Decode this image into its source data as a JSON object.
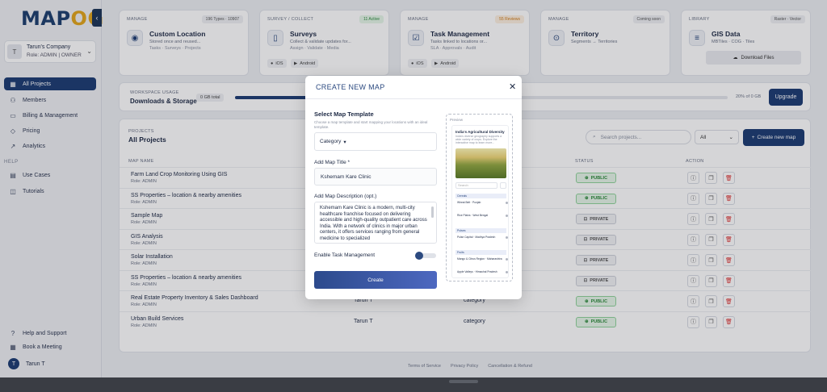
{
  "app": {
    "logo_text": "MAP",
    "logo_accent": "OG",
    "collapse_icon": "chevron-left-icon"
  },
  "company": {
    "avatar": "T",
    "name": "Tarun's Company",
    "role": "Role: ADMIN | OWNER"
  },
  "nav": {
    "items": [
      {
        "label": "All Projects",
        "icon": "grid-icon"
      },
      {
        "label": "Members",
        "icon": "user-icon"
      },
      {
        "label": "Billing & Management",
        "icon": "card-icon"
      },
      {
        "label": "Pricing",
        "icon": "tag-icon"
      },
      {
        "label": "Analytics",
        "icon": "chart-icon"
      }
    ],
    "help_heading": "HELP",
    "help_items": [
      {
        "label": "Use Cases",
        "icon": "document-icon"
      },
      {
        "label": "Tutorials",
        "icon": "book-icon"
      }
    ],
    "bottom_items": [
      {
        "label": "Help and Support",
        "icon": "help-icon"
      },
      {
        "label": "Book a Meeting",
        "icon": "calendar-icon"
      }
    ],
    "user": {
      "avatar": "T",
      "name": "Tarun T"
    }
  },
  "cards": [
    {
      "cat": "MANAGE",
      "badge": "196 Types · 10907",
      "title": "Custom Location",
      "d1": "Stored once and reused...",
      "d2": "Tasks · Surveys · Projects"
    },
    {
      "cat": "SURVEY / COLLECT",
      "badge": "11 Active",
      "title": "Surveys",
      "d1": "Collect & validate updates for...",
      "d2": "Assign · Validate · Media",
      "chips": [
        "iOS",
        "Android"
      ]
    },
    {
      "cat": "MANAGE",
      "badge": "55 Reviews",
      "title": "Task Management",
      "d1": "Tasks linked to locations or...",
      "d2": "SLA · Approvals · Audit",
      "chips": [
        "iOS",
        "Android"
      ]
    },
    {
      "cat": "MANAGE",
      "badge": "Coming soon",
      "title": "Territory",
      "d1": "Segments → Territories",
      "d2": ""
    },
    {
      "cat": "LIBRARY",
      "badge": "Raster · Vector",
      "title": "GIS Data",
      "d1": "MBTiles · COG · Tiles",
      "d2": "",
      "button": "Download Files"
    }
  ],
  "usage": {
    "label": "WORKSPACE USAGE",
    "title": "Downloads & Storage",
    "total": "0 GB total",
    "progress": 0.2,
    "pct_text": "20% of 0 GB",
    "upgrade": "Upgrade"
  },
  "projects": {
    "label": "PROJECTS",
    "title": "All Projects",
    "search_placeholder": "Search projects...",
    "filter": "All",
    "new_button": "Create new map",
    "headers": {
      "name": "MAP NAME",
      "status": "STATUS",
      "action": "ACTION"
    },
    "rows": [
      {
        "name": "Farm Land Crop Monitoring Using GIS",
        "role": "Role: ADMIN",
        "owner": "",
        "template": "",
        "status": "PUBLIC"
      },
      {
        "name": "SS Properties – location & nearby amenities",
        "role": "Role: ADMIN",
        "owner": "",
        "template": "",
        "status": "PUBLIC"
      },
      {
        "name": "Sample Map",
        "role": "Role: ADMIN",
        "owner": "",
        "template": "",
        "status": "PRIVATE"
      },
      {
        "name": "GIS Analysis",
        "role": "Role: ADMIN",
        "owner": "",
        "template": "",
        "status": "PRIVATE"
      },
      {
        "name": "Solar Installation",
        "role": "Role: ADMIN",
        "owner": "",
        "template": "",
        "status": "PRIVATE"
      },
      {
        "name": "SS Properties – location & nearby amenities",
        "role": "Role: ADMIN",
        "owner": "",
        "template": "",
        "status": "PRIVATE"
      },
      {
        "name": "Real Estate Property Inventory & Sales Dashboard",
        "role": "Role: ADMIN",
        "owner": "Tarun T",
        "template": "category",
        "status": "PUBLIC"
      },
      {
        "name": "Urban Build Services",
        "role": "Role: ADMIN",
        "owner": "Tarun T",
        "template": "category",
        "status": "PUBLIC"
      }
    ]
  },
  "footer": {
    "links": [
      "Terms of Service",
      "Privacy Policy",
      "Cancellation & Refund"
    ]
  },
  "modal": {
    "title": "CREATE NEW MAP",
    "section": "Select Map Template",
    "hint": "Choose a map template and start mapping your locations with an ideal template.",
    "template_value": "Category",
    "title_label": "Add Map Title *",
    "title_value": "Kshemam Kare Clinic",
    "desc_label": "Add Map Description (opt.)",
    "desc_value": "Kshemam Kare Clinic is a modern, multi-city healthcare franchise focused on delivering accessible and high-quality outpatient care across India. With a network of clinics in major urban centers, it offers services ranging from general medicine to specialized",
    "toggle_label": "Enable Task Management",
    "create_button": "Create",
    "preview": {
      "label": "Preview",
      "title": "India's Agricultural Diversity",
      "desc": "India's diverse geography supports a wide variety of crops. Explore the interactive map to learn more...",
      "search": "Search",
      "groups": [
        {
          "name": "Cereals",
          "items": [
            "Wheat Belt · Punjab",
            "Rice Plains · West Bengal"
          ]
        },
        {
          "name": "Pulses",
          "items": [
            "Pulse Capital · Madhya Pradesh"
          ]
        },
        {
          "name": "Fruits",
          "items": [
            "Mango & Citrus Region · Maharashtra",
            "Apple Valleys · Himachal Pradesh"
          ]
        }
      ]
    }
  },
  "colors": {
    "primary": "#1d3c73",
    "public_green": "#2d8a3b",
    "delete_red": "#dd3333"
  }
}
